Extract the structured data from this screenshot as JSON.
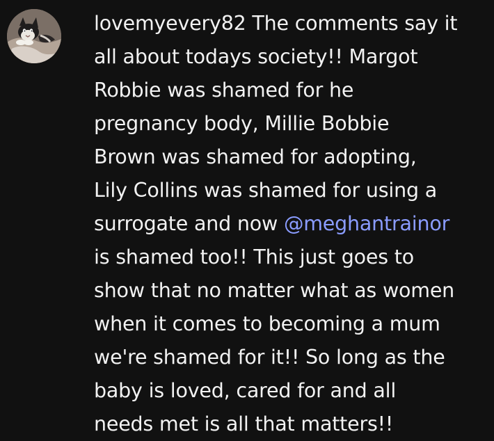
{
  "comment": {
    "username": "lovemyevery82",
    "text_line_1": " The comments say it",
    "text_lines": [
      "all about todays society!! Margot",
      "Robbie was shamed for he",
      "pregnancy body, Millie Bobbie",
      "Brown was shamed for adopting,",
      "Lily Collins was shamed for using a"
    ],
    "line_7_prefix": "surrogate and now ",
    "mention": "@meghantrainor",
    "text_lines_after": [
      "is shamed too!! This just goes to",
      "show that no matter what as women",
      "when it comes to becoming a mum",
      "we're shamed for it!! So long as the",
      "baby is loved, cared for and all",
      "needs met is all that matters!!"
    ]
  },
  "colors": {
    "background": "#111111",
    "text": "#f2f2f2",
    "mention": "#8a9cff"
  },
  "avatar": {
    "icon": "cat-avatar-icon"
  }
}
